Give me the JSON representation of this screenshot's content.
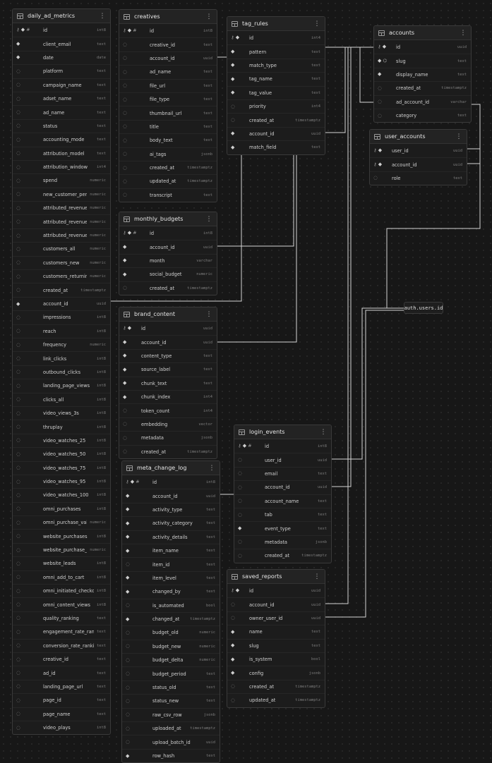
{
  "tables": [
    {
      "id": "daily_ad_metrics",
      "name": "daily_ad_metrics",
      "columns": [
        {
          "name": "id",
          "type": "int8",
          "icons": [
            "key",
            "diamond",
            "hash"
          ]
        },
        {
          "name": "client_email",
          "type": "text",
          "icons": [
            "diamond"
          ]
        },
        {
          "name": "date",
          "type": "date",
          "icons": [
            "diamond"
          ]
        },
        {
          "name": "platform",
          "type": "text",
          "icons": [
            "hollow"
          ]
        },
        {
          "name": "campaign_name",
          "type": "text",
          "icons": [
            "hollow"
          ]
        },
        {
          "name": "adset_name",
          "type": "text",
          "icons": [
            "hollow"
          ]
        },
        {
          "name": "ad_name",
          "type": "text",
          "icons": [
            "hollow"
          ]
        },
        {
          "name": "status",
          "type": "text",
          "icons": [
            "hollow"
          ]
        },
        {
          "name": "accounting_mode",
          "type": "text",
          "icons": [
            "hollow"
          ]
        },
        {
          "name": "attribution_model",
          "type": "text",
          "icons": [
            "hollow"
          ]
        },
        {
          "name": "attribution_window",
          "type": "int4",
          "icons": [
            "hollow"
          ]
        },
        {
          "name": "spend",
          "type": "numeric",
          "icons": [
            "hollow"
          ]
        },
        {
          "name": "new_customer_percen...",
          "type": "numeric",
          "icons": [
            "hollow"
          ]
        },
        {
          "name": "attributed_revenue",
          "type": "numeric",
          "icons": [
            "hollow"
          ]
        },
        {
          "name": "attributed_revenue_new",
          "type": "numeric",
          "icons": [
            "hollow"
          ]
        },
        {
          "name": "attributed_revenue_ret...",
          "type": "numeric",
          "icons": [
            "hollow"
          ]
        },
        {
          "name": "customers_all",
          "type": "numeric",
          "icons": [
            "hollow"
          ]
        },
        {
          "name": "customers_new",
          "type": "numeric",
          "icons": [
            "hollow"
          ]
        },
        {
          "name": "customers_returning",
          "type": "numeric",
          "icons": [
            "hollow"
          ]
        },
        {
          "name": "created_at",
          "type": "timestamptz",
          "icons": [
            "hollow"
          ]
        },
        {
          "name": "account_id",
          "type": "uuid",
          "icons": [
            "diamond"
          ]
        },
        {
          "name": "impressions",
          "type": "int8",
          "icons": [
            "hollow"
          ]
        },
        {
          "name": "reach",
          "type": "int8",
          "icons": [
            "hollow"
          ]
        },
        {
          "name": "frequency",
          "type": "numeric",
          "icons": [
            "hollow"
          ]
        },
        {
          "name": "link_clicks",
          "type": "int8",
          "icons": [
            "hollow"
          ]
        },
        {
          "name": "outbound_clicks",
          "type": "int8",
          "icons": [
            "hollow"
          ]
        },
        {
          "name": "landing_page_views",
          "type": "int8",
          "icons": [
            "hollow"
          ]
        },
        {
          "name": "clicks_all",
          "type": "int8",
          "icons": [
            "hollow"
          ]
        },
        {
          "name": "video_views_3s",
          "type": "int8",
          "icons": [
            "hollow"
          ]
        },
        {
          "name": "thruplay",
          "type": "int8",
          "icons": [
            "hollow"
          ]
        },
        {
          "name": "video_watches_25",
          "type": "int8",
          "icons": [
            "hollow"
          ]
        },
        {
          "name": "video_watches_50",
          "type": "int8",
          "icons": [
            "hollow"
          ]
        },
        {
          "name": "video_watches_75",
          "type": "int8",
          "icons": [
            "hollow"
          ]
        },
        {
          "name": "video_watches_95",
          "type": "int8",
          "icons": [
            "hollow"
          ]
        },
        {
          "name": "video_watches_100",
          "type": "int8",
          "icons": [
            "hollow"
          ]
        },
        {
          "name": "omni_purchases",
          "type": "int8",
          "icons": [
            "hollow"
          ]
        },
        {
          "name": "omni_purchase_value",
          "type": "numeric",
          "icons": [
            "hollow"
          ]
        },
        {
          "name": "website_purchases",
          "type": "int8",
          "icons": [
            "hollow"
          ]
        },
        {
          "name": "website_purchase_value",
          "type": "numeric",
          "icons": [
            "hollow"
          ]
        },
        {
          "name": "website_leads",
          "type": "int8",
          "icons": [
            "hollow"
          ]
        },
        {
          "name": "omni_add_to_cart",
          "type": "int8",
          "icons": [
            "hollow"
          ]
        },
        {
          "name": "omni_initiated_checkouts",
          "type": "int8",
          "icons": [
            "hollow"
          ]
        },
        {
          "name": "omni_content_views",
          "type": "int8",
          "icons": [
            "hollow"
          ]
        },
        {
          "name": "quality_ranking",
          "type": "text",
          "icons": [
            "hollow"
          ]
        },
        {
          "name": "engagement_rate_ranking",
          "type": "text",
          "icons": [
            "hollow"
          ]
        },
        {
          "name": "conversion_rate_ranking",
          "type": "text",
          "icons": [
            "hollow"
          ]
        },
        {
          "name": "creative_id",
          "type": "text",
          "icons": [
            "hollow"
          ]
        },
        {
          "name": "ad_id",
          "type": "text",
          "icons": [
            "hollow"
          ]
        },
        {
          "name": "landing_page_url",
          "type": "text",
          "icons": [
            "hollow"
          ]
        },
        {
          "name": "page_id",
          "type": "text",
          "icons": [
            "hollow"
          ]
        },
        {
          "name": "page_name",
          "type": "text",
          "icons": [
            "hollow"
          ]
        },
        {
          "name": "video_plays",
          "type": "int8",
          "icons": [
            "hollow"
          ]
        }
      ]
    },
    {
      "id": "creatives",
      "name": "creatives",
      "columns": [
        {
          "name": "id",
          "type": "int8",
          "icons": [
            "key",
            "diamond",
            "hash"
          ]
        },
        {
          "name": "creative_id",
          "type": "text",
          "icons": [
            "hollow"
          ]
        },
        {
          "name": "account_id",
          "type": "uuid",
          "icons": [
            "hollow"
          ]
        },
        {
          "name": "ad_name",
          "type": "text",
          "icons": [
            "hollow"
          ]
        },
        {
          "name": "file_url",
          "type": "text",
          "icons": [
            "hollow"
          ]
        },
        {
          "name": "file_type",
          "type": "text",
          "icons": [
            "hollow"
          ]
        },
        {
          "name": "thumbnail_url",
          "type": "text",
          "icons": [
            "hollow"
          ]
        },
        {
          "name": "title",
          "type": "text",
          "icons": [
            "hollow"
          ]
        },
        {
          "name": "body_text",
          "type": "text",
          "icons": [
            "hollow"
          ]
        },
        {
          "name": "ai_tags",
          "type": "jsonb",
          "icons": [
            "hollow"
          ]
        },
        {
          "name": "created_at",
          "type": "timestamptz",
          "icons": [
            "hollow"
          ]
        },
        {
          "name": "updated_at",
          "type": "timestamptz",
          "icons": [
            "hollow"
          ]
        },
        {
          "name": "transcript",
          "type": "text",
          "icons": [
            "hollow"
          ]
        }
      ]
    },
    {
      "id": "monthly_budgets",
      "name": "monthly_budgets",
      "columns": [
        {
          "name": "id",
          "type": "int8",
          "icons": [
            "key",
            "diamond",
            "hash"
          ]
        },
        {
          "name": "account_id",
          "type": "uuid",
          "icons": [
            "diamond"
          ]
        },
        {
          "name": "month",
          "type": "varchar",
          "icons": [
            "diamond"
          ]
        },
        {
          "name": "social_budget",
          "type": "numeric",
          "icons": [
            "diamond"
          ]
        },
        {
          "name": "created_at",
          "type": "timestamptz",
          "icons": [
            "hollow"
          ]
        }
      ]
    },
    {
      "id": "brand_content",
      "name": "brand_content",
      "columns": [
        {
          "name": "id",
          "type": "uuid",
          "icons": [
            "key",
            "diamond"
          ]
        },
        {
          "name": "account_id",
          "type": "uuid",
          "icons": [
            "diamond"
          ]
        },
        {
          "name": "content_type",
          "type": "text",
          "icons": [
            "diamond"
          ]
        },
        {
          "name": "source_label",
          "type": "text",
          "icons": [
            "diamond"
          ]
        },
        {
          "name": "chunk_text",
          "type": "text",
          "icons": [
            "diamond"
          ]
        },
        {
          "name": "chunk_index",
          "type": "int4",
          "icons": [
            "diamond"
          ]
        },
        {
          "name": "token_count",
          "type": "int4",
          "icons": [
            "hollow"
          ]
        },
        {
          "name": "embedding",
          "type": "vector",
          "icons": [
            "hollow"
          ]
        },
        {
          "name": "metadata",
          "type": "jsonb",
          "icons": [
            "hollow"
          ]
        },
        {
          "name": "created_at",
          "type": "timestamptz",
          "icons": [
            "hollow"
          ]
        }
      ]
    },
    {
      "id": "meta_change_log",
      "name": "meta_change_log",
      "columns": [
        {
          "name": "id",
          "type": "int8",
          "icons": [
            "key",
            "diamond",
            "hash"
          ]
        },
        {
          "name": "account_id",
          "type": "uuid",
          "icons": [
            "diamond"
          ]
        },
        {
          "name": "activity_type",
          "type": "text",
          "icons": [
            "diamond"
          ]
        },
        {
          "name": "activity_category",
          "type": "text",
          "icons": [
            "diamond"
          ]
        },
        {
          "name": "activity_details",
          "type": "text",
          "icons": [
            "diamond"
          ]
        },
        {
          "name": "item_name",
          "type": "text",
          "icons": [
            "diamond"
          ]
        },
        {
          "name": "item_id",
          "type": "text",
          "icons": [
            "hollow"
          ]
        },
        {
          "name": "item_level",
          "type": "text",
          "icons": [
            "diamond"
          ]
        },
        {
          "name": "changed_by",
          "type": "text",
          "icons": [
            "diamond"
          ]
        },
        {
          "name": "is_automated",
          "type": "bool",
          "icons": [
            "hollow"
          ]
        },
        {
          "name": "changed_at",
          "type": "timestamptz",
          "icons": [
            "diamond"
          ]
        },
        {
          "name": "budget_old",
          "type": "numeric",
          "icons": [
            "hollow"
          ]
        },
        {
          "name": "budget_new",
          "type": "numeric",
          "icons": [
            "hollow"
          ]
        },
        {
          "name": "budget_delta",
          "type": "numeric",
          "icons": [
            "hollow"
          ]
        },
        {
          "name": "budget_period",
          "type": "text",
          "icons": [
            "hollow"
          ]
        },
        {
          "name": "status_old",
          "type": "text",
          "icons": [
            "hollow"
          ]
        },
        {
          "name": "status_new",
          "type": "text",
          "icons": [
            "hollow"
          ]
        },
        {
          "name": "raw_csv_row",
          "type": "jsonb",
          "icons": [
            "hollow"
          ]
        },
        {
          "name": "uploaded_at",
          "type": "timestamptz",
          "icons": [
            "hollow"
          ]
        },
        {
          "name": "upload_batch_id",
          "type": "uuid",
          "icons": [
            "hollow"
          ]
        },
        {
          "name": "row_hash",
          "type": "text",
          "icons": [
            "diamond"
          ]
        }
      ]
    },
    {
      "id": "tag_rules",
      "name": "tag_rules",
      "columns": [
        {
          "name": "id",
          "type": "int4",
          "icons": [
            "key",
            "diamond"
          ]
        },
        {
          "name": "pattern",
          "type": "text",
          "icons": [
            "diamond"
          ]
        },
        {
          "name": "match_type",
          "type": "text",
          "icons": [
            "diamond"
          ]
        },
        {
          "name": "tag_name",
          "type": "text",
          "icons": [
            "diamond"
          ]
        },
        {
          "name": "tag_value",
          "type": "text",
          "icons": [
            "diamond"
          ]
        },
        {
          "name": "priority",
          "type": "int4",
          "icons": [
            "hollow"
          ]
        },
        {
          "name": "created_at",
          "type": "timestamptz",
          "icons": [
            "hollow"
          ]
        },
        {
          "name": "account_id",
          "type": "uuid",
          "icons": [
            "diamond"
          ]
        },
        {
          "name": "match_field",
          "type": "text",
          "icons": [
            "diamond"
          ]
        }
      ]
    },
    {
      "id": "login_events",
      "name": "login_events",
      "columns": [
        {
          "name": "id",
          "type": "int8",
          "icons": [
            "key",
            "diamond",
            "hash"
          ]
        },
        {
          "name": "user_id",
          "type": "uuid",
          "icons": [
            "hollow"
          ]
        },
        {
          "name": "email",
          "type": "text",
          "icons": [
            "hollow"
          ]
        },
        {
          "name": "account_id",
          "type": "uuid",
          "icons": [
            "hollow"
          ]
        },
        {
          "name": "account_name",
          "type": "text",
          "icons": [
            "hollow"
          ]
        },
        {
          "name": "tab",
          "type": "text",
          "icons": [
            "hollow"
          ]
        },
        {
          "name": "event_type",
          "type": "text",
          "icons": [
            "diamond"
          ]
        },
        {
          "name": "metadata",
          "type": "jsonb",
          "icons": [
            "hollow"
          ]
        },
        {
          "name": "created_at",
          "type": "timestamptz",
          "icons": [
            "hollow"
          ]
        }
      ]
    },
    {
      "id": "saved_reports",
      "name": "saved_reports",
      "columns": [
        {
          "name": "id",
          "type": "uuid",
          "icons": [
            "key",
            "diamond"
          ]
        },
        {
          "name": "account_id",
          "type": "uuid",
          "icons": [
            "hollow"
          ]
        },
        {
          "name": "owner_user_id",
          "type": "uuid",
          "icons": [
            "hollow"
          ]
        },
        {
          "name": "name",
          "type": "text",
          "icons": [
            "diamond"
          ]
        },
        {
          "name": "slug",
          "type": "text",
          "icons": [
            "diamond"
          ]
        },
        {
          "name": "is_system",
          "type": "bool",
          "icons": [
            "diamond"
          ]
        },
        {
          "name": "config",
          "type": "jsonb",
          "icons": [
            "diamond"
          ]
        },
        {
          "name": "created_at",
          "type": "timestamptz",
          "icons": [
            "hollow"
          ]
        },
        {
          "name": "updated_at",
          "type": "timestamptz",
          "icons": [
            "hollow"
          ]
        }
      ]
    },
    {
      "id": "accounts",
      "name": "accounts",
      "columns": [
        {
          "name": "id",
          "type": "uuid",
          "icons": [
            "key",
            "diamond"
          ]
        },
        {
          "name": "slug",
          "type": "text",
          "icons": [
            "diamond",
            "fingerprint"
          ]
        },
        {
          "name": "display_name",
          "type": "text",
          "icons": [
            "diamond"
          ]
        },
        {
          "name": "created_at",
          "type": "timestamptz",
          "icons": [
            "hollow"
          ]
        },
        {
          "name": "ad_account_id",
          "type": "varchar",
          "icons": [
            "hollow"
          ]
        },
        {
          "name": "category",
          "type": "text",
          "icons": [
            "hollow"
          ]
        }
      ]
    },
    {
      "id": "user_accounts",
      "name": "user_accounts",
      "columns": [
        {
          "name": "user_id",
          "type": "uuid",
          "icons": [
            "key",
            "diamond"
          ]
        },
        {
          "name": "account_id",
          "type": "uuid",
          "icons": [
            "key",
            "diamond"
          ]
        },
        {
          "name": "role",
          "type": "text",
          "icons": [
            "hollow"
          ]
        }
      ]
    }
  ],
  "external_label": "auth.users.id",
  "menu_glyph": "⋮"
}
